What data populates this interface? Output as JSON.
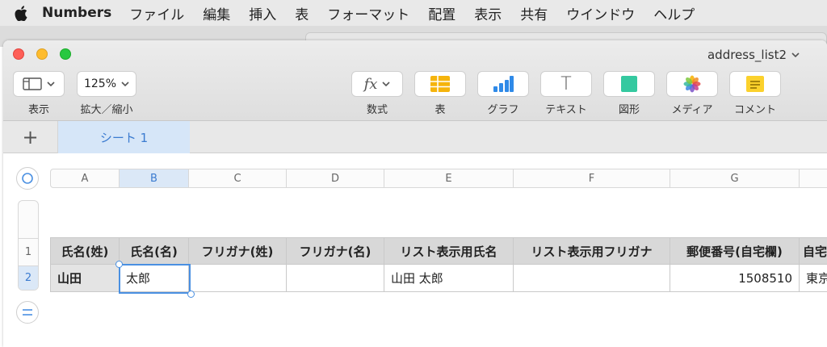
{
  "menubar": {
    "app_name": "Numbers",
    "items": [
      "ファイル",
      "編集",
      "挿入",
      "表",
      "フォーマット",
      "配置",
      "表示",
      "共有",
      "ウインドウ",
      "ヘルプ"
    ]
  },
  "window": {
    "doc_title": "address_list2"
  },
  "toolbar": {
    "view_label": "表示",
    "zoom_value": "125%",
    "zoom_label": "拡大／縮小",
    "formula_glyph": "fx",
    "formula_label": "数式",
    "table_label": "表",
    "chart_label": "グラフ",
    "text_glyph": "T",
    "text_label": "テキスト",
    "shape_label": "図形",
    "media_label": "メディア",
    "comment_label": "コメント"
  },
  "tabs": {
    "add": "+",
    "sheets": [
      "シート 1"
    ]
  },
  "grid": {
    "columns": [
      "A",
      "B",
      "C",
      "D",
      "E",
      "F",
      "G"
    ],
    "rows": [
      "1",
      "2"
    ],
    "header_row": [
      "氏名(姓)",
      "氏名(名)",
      "フリガナ(姓)",
      "フリガナ(名)",
      "リスト表示用氏名",
      "リスト表示用フリガナ",
      "郵便番号(自宅欄)",
      "自宅"
    ],
    "data_row": [
      "山田",
      "太郎",
      "",
      "",
      "山田 太郎",
      "",
      "1508510",
      "東京"
    ]
  },
  "colors": {
    "accent": "#4a90e2",
    "selected_header_bg": "#dbe8f7",
    "table_header_bg": "#d8d8d8"
  }
}
